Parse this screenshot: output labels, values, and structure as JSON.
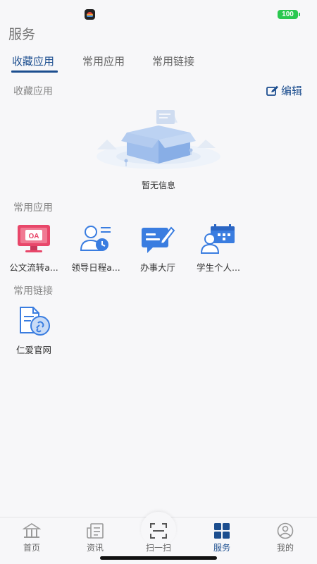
{
  "status_bar": {
    "battery": "100"
  },
  "page_title": "服务",
  "tabs": [
    {
      "label": "收藏应用",
      "active": true
    },
    {
      "label": "常用应用",
      "active": false
    },
    {
      "label": "常用链接",
      "active": false
    }
  ],
  "favorites": {
    "title": "收藏应用",
    "edit_label": "编辑",
    "empty_text": "暂无信息"
  },
  "common_apps": {
    "title": "常用应用",
    "items": [
      {
        "label": "公文流转a...",
        "icon": "oa-monitor-icon"
      },
      {
        "label": "领导日程a...",
        "icon": "leader-schedule-icon"
      },
      {
        "label": "办事大厅",
        "icon": "service-hall-icon"
      },
      {
        "label": "学生个人...",
        "icon": "student-personal-icon"
      }
    ]
  },
  "common_links": {
    "title": "常用链接",
    "items": [
      {
        "label": "仁爱官网",
        "icon": "link-document-icon"
      }
    ]
  },
  "bottom_nav": [
    {
      "label": "首页",
      "icon": "home-building-icon",
      "active": false
    },
    {
      "label": "资讯",
      "icon": "news-icon",
      "active": false
    },
    {
      "label": "扫一扫",
      "icon": "scan-icon",
      "active": false
    },
    {
      "label": "服务",
      "icon": "service-grid-icon",
      "active": true
    },
    {
      "label": "我的",
      "icon": "profile-icon",
      "active": false
    }
  ],
  "colors": {
    "accent": "#1c4e8f",
    "icon_blue": "#3a7de0",
    "oa_pink": "#e8476a",
    "battery_green": "#2ac84f"
  }
}
